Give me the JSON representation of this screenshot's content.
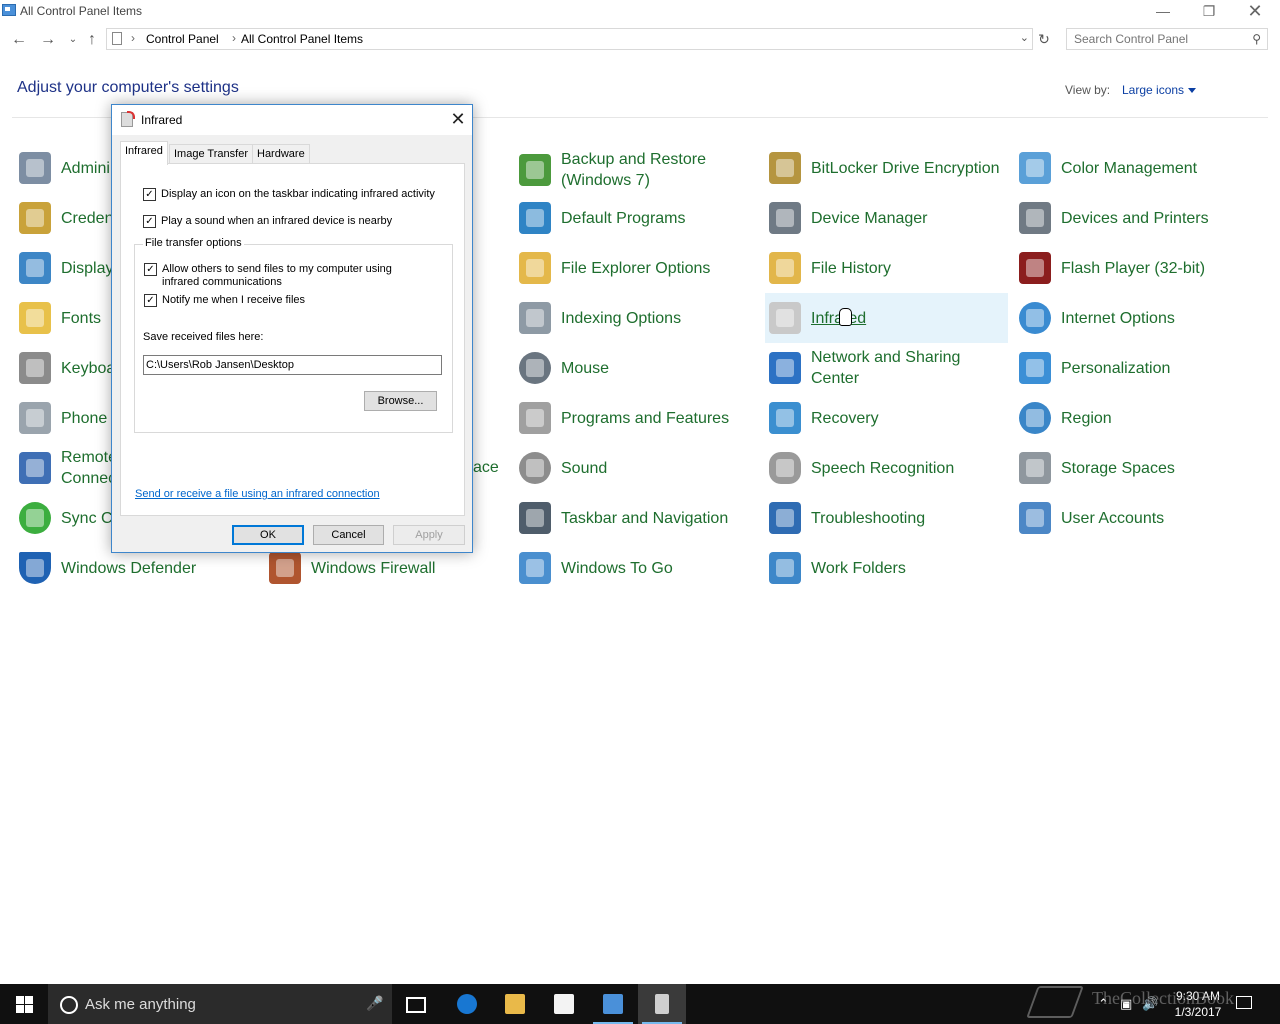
{
  "window": {
    "title": "All Control Panel Items"
  },
  "address": {
    "crumbs": [
      "Control Panel",
      "All Control Panel Items"
    ],
    "search_placeholder": "Search Control Panel"
  },
  "header": {
    "title": "Adjust your computer's settings",
    "view_by_label": "View by:",
    "view_by_value": "Large icons"
  },
  "items": {
    "admin": {
      "label": "Admini",
      "icon": "administrative-tools-icon",
      "color": "#7d8ea3"
    },
    "cred": {
      "label": "Creden",
      "icon": "credential-manager-icon",
      "color": "#c9a23a"
    },
    "display": {
      "label": "Display",
      "icon": "display-icon",
      "color": "#3d86c6"
    },
    "fonts": {
      "label": "Fonts",
      "icon": "fonts-icon",
      "color": "#e8c14a"
    },
    "keyboard": {
      "label": "Keyboa",
      "icon": "keyboard-icon",
      "color": "#8b8b8b"
    },
    "phone": {
      "label": "Phone",
      "icon": "phone-icon",
      "color": "#9aa4ad"
    },
    "remote": {
      "label": "Remote Connec",
      "icon": "remote-app-icon",
      "color": "#3f6fb5"
    },
    "sync": {
      "label": "Sync Ce",
      "icon": "sync-center-icon",
      "color": "#3cae3f"
    },
    "defender": {
      "label": "Windows Defender",
      "icon": "windows-defender-icon",
      "color": "#1f62b3"
    },
    "firewall": {
      "label": "Windows Firewall",
      "icon": "windows-firewall-icon",
      "color": "#b0552f"
    },
    "sound_frag": {
      "label": "ace"
    },
    "backup": {
      "label": "Backup and Restore (Windows 7)",
      "icon": "backup-restore-icon",
      "color": "#4c9a3d"
    },
    "default_programs": {
      "label": "Default Programs",
      "icon": "default-programs-icon",
      "color": "#2f84c5"
    },
    "file_explorer": {
      "label": "File Explorer Options",
      "icon": "file-explorer-options-icon",
      "color": "#e4b84a"
    },
    "indexing": {
      "label": "Indexing Options",
      "icon": "indexing-options-icon",
      "color": "#8e9aa5"
    },
    "mouse": {
      "label": "Mouse",
      "icon": "mouse-icon",
      "color": "#6a7580"
    },
    "programs": {
      "label": "Programs and Features",
      "icon": "programs-features-icon",
      "color": "#a0a0a0"
    },
    "sound": {
      "label": "Sound",
      "icon": "sound-icon",
      "color": "#8d8d8d"
    },
    "taskbar_nav": {
      "label": "Taskbar and Navigation",
      "icon": "taskbar-navigation-icon",
      "color": "#4f5d6b"
    },
    "wtg": {
      "label": "Windows To Go",
      "icon": "windows-to-go-icon",
      "color": "#4a8fcf"
    },
    "bitlocker": {
      "label": "BitLocker Drive Encryption",
      "icon": "bitlocker-icon",
      "color": "#b59540"
    },
    "device_manager": {
      "label": "Device Manager",
      "icon": "device-manager-icon",
      "color": "#6f7a85"
    },
    "file_history": {
      "label": "File History",
      "icon": "file-history-icon",
      "color": "#e2b64a"
    },
    "infrared": {
      "label": "Infrared",
      "icon": "infrared-icon",
      "color": "#c9c9c9"
    },
    "network": {
      "label": "Network and Sharing Center",
      "icon": "network-sharing-icon",
      "color": "#2d72c4"
    },
    "recovery": {
      "label": "Recovery",
      "icon": "recovery-icon",
      "color": "#3b8fd0"
    },
    "speech": {
      "label": "Speech Recognition",
      "icon": "speech-recognition-icon",
      "color": "#9a9a9a"
    },
    "troubleshoot": {
      "label": "Troubleshooting",
      "icon": "troubleshooting-icon",
      "color": "#2f6cb3"
    },
    "work_folders": {
      "label": "Work Folders",
      "icon": "work-folders-icon",
      "color": "#3d87c9"
    },
    "color_mgmt": {
      "label": "Color Management",
      "icon": "color-management-icon",
      "color": "#5aa0d8"
    },
    "devices_printers": {
      "label": "Devices and Printers",
      "icon": "devices-printers-icon",
      "color": "#707a84"
    },
    "flash": {
      "label": "Flash Player (32-bit)",
      "icon": "flash-player-icon",
      "color": "#8b1e1e"
    },
    "internet_options": {
      "label": "Internet Options",
      "icon": "internet-options-icon",
      "color": "#3a8bd1"
    },
    "personalization": {
      "label": "Personalization",
      "icon": "personalization-icon",
      "color": "#3b8fd6"
    },
    "region": {
      "label": "Region",
      "icon": "region-icon",
      "color": "#3a86c8"
    },
    "storage": {
      "label": "Storage Spaces",
      "icon": "storage-spaces-icon",
      "color": "#8f979e"
    },
    "user_accounts": {
      "label": "User Accounts",
      "icon": "user-accounts-icon",
      "color": "#4c87c6"
    }
  },
  "dialog": {
    "title": "Infrared",
    "tabs": [
      "Infrared",
      "Image Transfer",
      "Hardware"
    ],
    "options": {
      "taskbar_icon": {
        "label": "Display an icon on the taskbar indicating infrared activity",
        "checked": true
      },
      "sound": {
        "label": "Play a sound when an infrared device is nearby",
        "checked": true
      },
      "allow_send": {
        "label": "Allow others to send files to my computer using infrared communications",
        "checked": true
      },
      "notify": {
        "label": "Notify me when I receive files",
        "checked": true
      }
    },
    "group_title": "File transfer options",
    "save_label": "Save received files here:",
    "save_path": "C:\\Users\\Rob Jansen\\Desktop",
    "browse": "Browse...",
    "link": "Send or receive a file using an infrared connection",
    "ok": "OK",
    "cancel": "Cancel",
    "apply": "Apply"
  },
  "taskbar": {
    "search_placeholder": "Ask me anything",
    "time": "9:30 AM",
    "date": "1/3/2017",
    "watermark": "TheCollectionBook"
  }
}
